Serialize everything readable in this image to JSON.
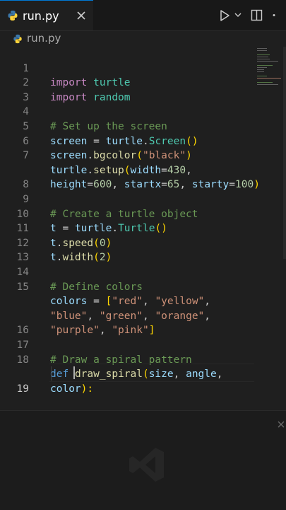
{
  "tab": {
    "label": "run.py"
  },
  "breadcrumb": {
    "label": "run.py"
  },
  "editor": {
    "line_numbers": [
      "1",
      "2",
      "3",
      "4",
      "5",
      "6",
      "7",
      "",
      "8",
      "9",
      "10",
      "11",
      "12",
      "13",
      "14",
      "15",
      "",
      "",
      "16",
      "17",
      "18",
      "",
      "19"
    ],
    "code": {
      "l1": [
        "import",
        " ",
        "turtle"
      ],
      "l2": [
        "import",
        " ",
        "random"
      ],
      "l4": "# Set up the screen",
      "l5": [
        "screen",
        " = ",
        "turtle",
        ".",
        "Screen",
        "(",
        ")"
      ],
      "l6": [
        "screen",
        ".",
        "bgcolor",
        "(",
        "\"black\"",
        ")"
      ],
      "l7": [
        "turtle",
        ".",
        "setup",
        "(",
        "width",
        "=",
        "430",
        ","
      ],
      "l7b": [
        "height",
        "=",
        "600",
        ", ",
        "startx",
        "=",
        "65",
        ", ",
        "starty",
        "=",
        "100",
        ")"
      ],
      "l9": "# Create a turtle object",
      "l10": [
        "t",
        " = ",
        "turtle",
        ".",
        "Turtle",
        "(",
        ")"
      ],
      "l11": [
        "t",
        ".",
        "speed",
        "(",
        "0",
        ")"
      ],
      "l12": [
        "t",
        ".",
        "width",
        "(",
        "2",
        ")"
      ],
      "l14": "# Define colors",
      "l15": [
        "colors",
        " = ",
        "[",
        "\"red\"",
        ", ",
        "\"yellow\"",
        ","
      ],
      "l15b": [
        "\"blue\"",
        ", ",
        "\"green\"",
        ", ",
        "\"orange\"",
        ","
      ],
      "l15c": [
        "\"purple\"",
        ", ",
        "\"pink\"",
        "]"
      ],
      "l17": "# Draw a spiral pattern",
      "l18": [
        "def",
        " ",
        "draw_spiral",
        "(",
        "size",
        ", ",
        "angle",
        ","
      ],
      "l18b": [
        "color",
        "):"
      ]
    }
  },
  "icons": {
    "file": "python-file-icon",
    "close": "close-icon",
    "run": "run-icon",
    "dropdown": "chevron-down-icon",
    "split": "split-editor-icon",
    "more": "more-actions-icon",
    "panel_close": "close-icon",
    "watermark": "vscode-logo-icon"
  },
  "colors": {
    "background": "#1f1f1f",
    "keyword": "#c586c0",
    "variable": "#9cdcfe",
    "function": "#dcdcaa",
    "class": "#4ec9b0",
    "string": "#ce9178",
    "number": "#b5cea8",
    "comment": "#6a9955"
  }
}
